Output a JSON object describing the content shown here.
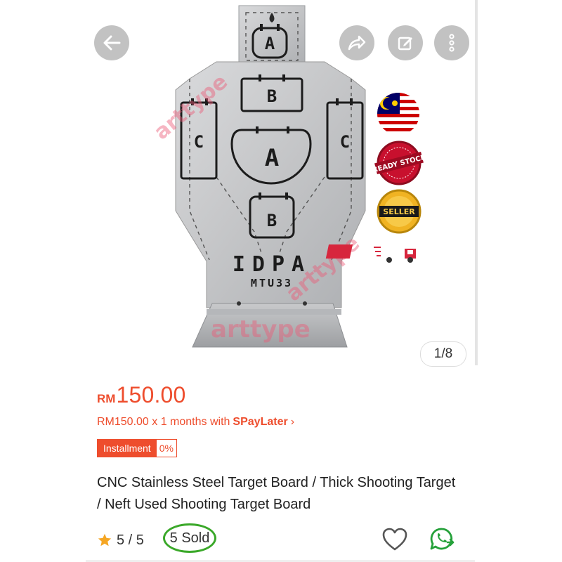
{
  "gallery": {
    "counter": "1/8",
    "badges": {
      "ready_stock": "READY STOCK",
      "seller": "SELLER",
      "fast_delivery": "FAST"
    },
    "product_image_text": {
      "zone_a_top": "A",
      "zone_b_top": "B",
      "zone_c_left": "C",
      "zone_a_mid": "A",
      "zone_c_right": "C",
      "zone_b_low": "B",
      "brand": "IDPA",
      "model": "MTU33",
      "watermark": "arttype"
    }
  },
  "price": {
    "currency": "RM",
    "value": "150.00"
  },
  "spaylater": {
    "prefix": "RM150.00 x 1 months with",
    "brand": "SPayLater",
    "chevron": "›"
  },
  "installment": {
    "label": "Installment",
    "rate": "0%"
  },
  "product": {
    "title": "CNC Stainless Steel Target Board /  Thick Shooting Target / Neft Used Shooting Target Board"
  },
  "rating": {
    "score": "5 / 5",
    "sold": "5 Sold"
  },
  "colors": {
    "brand": "#ee4d2d",
    "star": "#f5a623",
    "whatsapp": "#25a13a",
    "highlight": "#3aa829"
  }
}
